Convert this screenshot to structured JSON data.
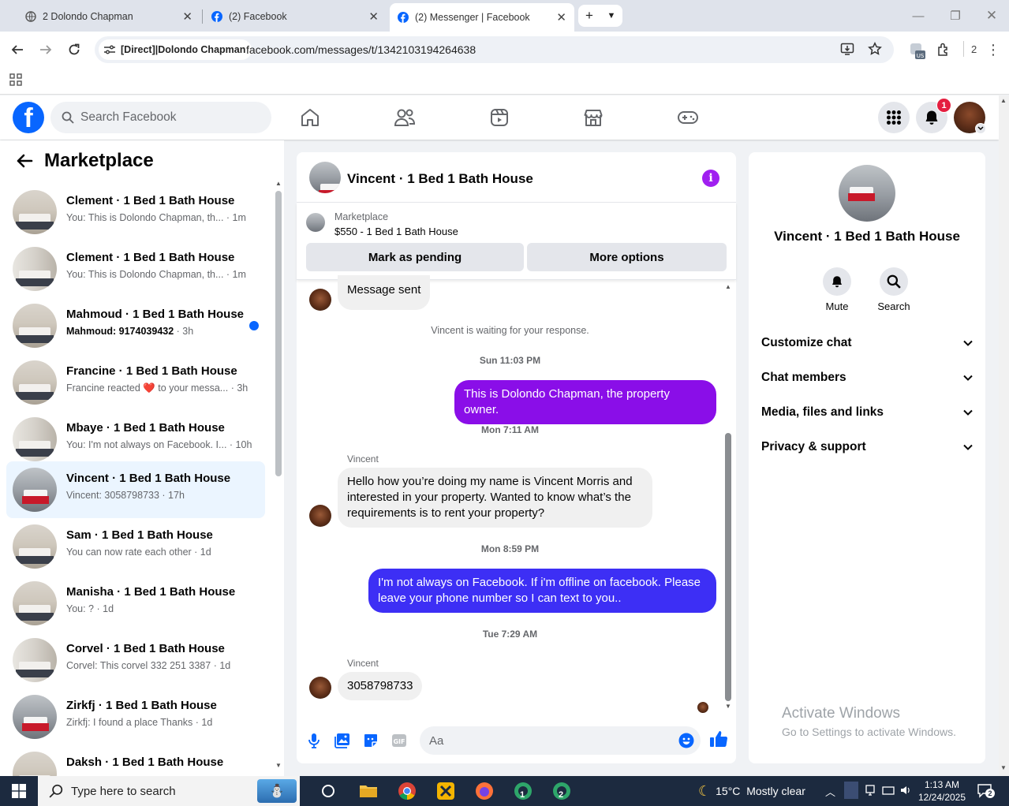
{
  "browser": {
    "tabs": [
      {
        "title": "2 Dolondo Chapman",
        "icon": "globe-icon"
      },
      {
        "title": "(2) Facebook",
        "icon": "facebook-icon"
      },
      {
        "title": "(2) Messenger | Facebook",
        "icon": "facebook-icon"
      }
    ],
    "site_chip": "[Direct]|Dolondo Chapman",
    "url": "facebook.com/messages/t/1342103194264638",
    "profile_count": "2"
  },
  "fb_header": {
    "search_placeholder": "Search Facebook",
    "notification_count": "1",
    "nav": [
      "home-icon",
      "friends-icon",
      "video-icon",
      "marketplace-icon",
      "gaming-icon"
    ]
  },
  "left_panel": {
    "title": "Marketplace",
    "conversations": [
      {
        "name": "Clement · 1 Bed 1 Bath House",
        "snippet": "You: This is Dolondo Chapman, th...",
        "time": "· 1m",
        "unread": false,
        "selected": false
      },
      {
        "name": "Clement · 1 Bed 1 Bath House",
        "snippet": "You: This is Dolondo Chapman, th...",
        "time": "· 1m",
        "unread": false,
        "selected": false
      },
      {
        "name": "Mahmoud · 1 Bed 1 Bath House",
        "snippet": "Mahmoud: 9174039432",
        "time": "· 3h",
        "unread": true,
        "selected": false
      },
      {
        "name": "Francine · 1 Bed 1 Bath House",
        "snippet": "Francine reacted ❤️ to your messa...",
        "time": "· 3h",
        "unread": false,
        "selected": false
      },
      {
        "name": "Mbaye · 1 Bed 1 Bath House",
        "snippet": "You: I'm not always on Facebook. I...",
        "time": "· 10h",
        "unread": false,
        "selected": false
      },
      {
        "name": "Vincent · 1 Bed 1 Bath House",
        "snippet": "Vincent: 3058798733",
        "time": "· 17h",
        "unread": false,
        "selected": true
      },
      {
        "name": "Sam · 1 Bed 1 Bath House",
        "snippet": "You can now rate each other",
        "time": "· 1d",
        "unread": false,
        "selected": false
      },
      {
        "name": "Manisha · 1 Bed 1 Bath House",
        "snippet": "You: ?",
        "time": "· 1d",
        "unread": false,
        "selected": false
      },
      {
        "name": "Corvel · 1 Bed 1 Bath House",
        "snippet": "Corvel: This corvel 332 251 3387",
        "time": "· 1d",
        "unread": false,
        "selected": false
      },
      {
        "name": "Zirkfj · 1 Bed 1 Bath House",
        "snippet": "Zirkfj: I found a place Thanks",
        "time": "· 1d",
        "unread": false,
        "selected": false
      },
      {
        "name": "Daksh · 1 Bed 1 Bath House",
        "snippet": "",
        "time": "",
        "unread": false,
        "selected": false
      }
    ]
  },
  "chat": {
    "title": "Vincent · 1 Bed 1 Bath House",
    "marketplace_label": "Marketplace",
    "listing": "$550 - 1 Bed 1 Bath House",
    "buttons": {
      "pending": "Mark as pending",
      "more": "More options"
    },
    "messages": {
      "sent_notice": "Message sent",
      "waiting": "Vincent is waiting for your response.",
      "ts1": "Sun 11:03 PM",
      "out1": "This is Dolondo Chapman, the property owner.",
      "ts2": "Mon 7:11 AM",
      "sender1": "Vincent",
      "in1": "Hello how you’re doing my name is Vincent Morris and interested in your property. Wanted to know what’s the requirements is to rent your property?",
      "ts3": "Mon 8:59 PM",
      "out2": "I'm not always on Facebook. If i'm offline on facebook. Please leave your phone number so I can text to you..",
      "ts4": "Tue 7:29 AM",
      "sender2": "Vincent",
      "in2": "3058798733"
    },
    "colors": {
      "out1": "#8a0ee8",
      "out2": "#3d2ff5",
      "accent": "#a020f0"
    },
    "input_placeholder": "Aa"
  },
  "right_panel": {
    "name": "Vincent · 1 Bed 1 Bath House",
    "actions": {
      "mute": "Mute",
      "search": "Search"
    },
    "sections": [
      "Customize chat",
      "Chat members",
      "Media, files and links",
      "Privacy & support"
    ]
  },
  "watermark": {
    "line1": "Activate Windows",
    "line2": "Go to Settings to activate Windows."
  },
  "taskbar": {
    "search_placeholder": "Type here to search",
    "weather": "15°C  Mostly clear",
    "time": "1:13 AM",
    "date": "12/24/2025",
    "notifications": "2",
    "app_badges": [
      "1",
      "2"
    ]
  }
}
